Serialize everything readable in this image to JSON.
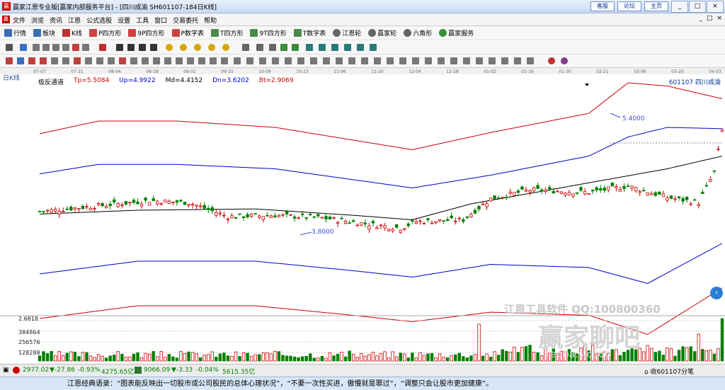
{
  "window": {
    "title": "赢家江恩专业版[赢家内部服务平台] - [四川成渝  SH601107-184日K线]",
    "links": [
      "客服",
      "论坛",
      "主页"
    ],
    "controls": [
      "_",
      "□",
      "×"
    ]
  },
  "menu": {
    "items": [
      "文件",
      "浏览",
      "资讯",
      "江恩",
      "公式选股",
      "设置",
      "工具",
      "窗口",
      "交易委托",
      "帮助"
    ],
    "mdi_controls": [
      "_",
      "□",
      "×"
    ]
  },
  "toolbar": {
    "buttons": [
      "行情",
      "板块",
      "K线",
      "P四方形",
      "9P四方形",
      "P数字表",
      "T四方形",
      "9T四方形",
      "T数字表",
      "江恩轮",
      "赢家轮",
      "六角形",
      "赢家服务"
    ]
  },
  "chart_data": {
    "type": "candlestick",
    "panel_label": "日K线",
    "indicator_name": "极反通道",
    "indicator_values": [
      {
        "label": "Tp",
        "value": "5.5084",
        "color": "#cc0000"
      },
      {
        "label": "Up",
        "value": "4.9922",
        "color": "#0000cc"
      },
      {
        "label": "Md",
        "value": "4.4152",
        "color": "#000000"
      },
      {
        "label": "Dn",
        "value": "3.6202",
        "color": "#0000cc"
      },
      {
        "label": "Bt",
        "value": "2.9069",
        "color": "#cc0000"
      }
    ],
    "stock_label": "601107  四川成渝",
    "date_ticks": [
      "07-07",
      "07-21",
      "08-04",
      "08-18",
      "09-01",
      "09-15",
      "10-09",
      "10-23",
      "11-06",
      "11-20",
      "12-04",
      "12-18",
      "01-02",
      "01-16",
      "01-30",
      "02-21",
      "03-06",
      "03-20",
      "04-03"
    ],
    "low_marker": "3.8000",
    "high_marker": "5.4000",
    "volume_axis": [
      "2.6818",
      "384864",
      "256576",
      "128288"
    ],
    "colors": {
      "up": "#cc0000",
      "down": "#008000",
      "band_outer": "#cc0000",
      "band_inner": "#0000cc",
      "mid": "#000000"
    }
  },
  "watermark": {
    "line1": "江恩工具软件    QQ:100800360",
    "line2": "赢家聊吧",
    "line3": "liaoba.v.c360"
  },
  "status": {
    "sh": {
      "index": "2977.02",
      "change": "▼-27.86",
      "pct": "-0.93%",
      "amount": "4275.65亿"
    },
    "sz": {
      "index": "9066.09",
      "change": "▼-3.33",
      "pct": "-0.04%",
      "amount": "5615.35亿"
    },
    "right": "收601107分笔"
  },
  "quote": "江恩经典语录：“图表能反映出一切股市或公司股民的总体心理状况”，“不要一次性买进，傲慢就是罪过”，“调整只会让股市更加健康”。"
}
